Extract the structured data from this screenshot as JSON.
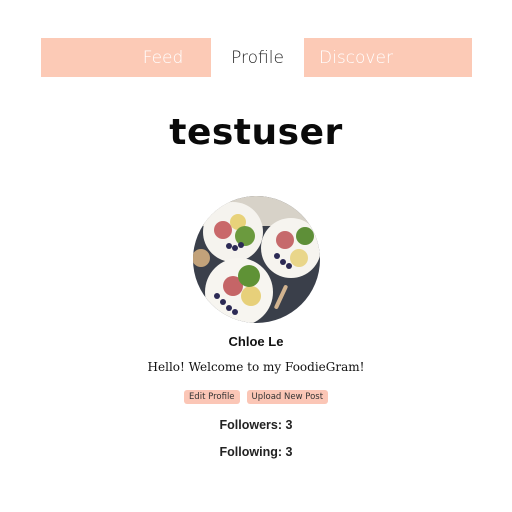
{
  "nav": {
    "tabs": [
      {
        "label": "Feed"
      },
      {
        "label": "Profile"
      },
      {
        "label": "Discover"
      }
    ],
    "accent_color": "#fccab6"
  },
  "profile": {
    "username": "testuser",
    "display_name": "Chloe Le",
    "bio": "Hello! Welcome to my FoodieGram!",
    "avatar_icon": "food-photo-avatar",
    "edit_label": "Edit Profile",
    "upload_label": "Upload New Post",
    "followers_text": "Followers: 3",
    "following_text": "Following: 3"
  }
}
